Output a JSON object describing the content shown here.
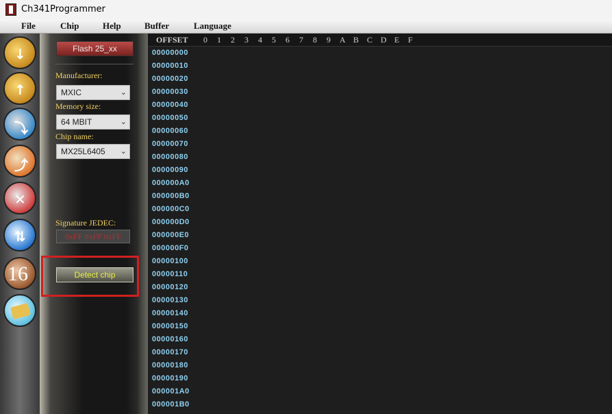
{
  "window": {
    "title": "Ch341Programmer"
  },
  "menu": {
    "items": [
      "File",
      "Chip",
      "Help",
      "Buffer",
      "Language"
    ]
  },
  "toolbar": {
    "buttons": [
      {
        "icon": "open-file-icon"
      },
      {
        "icon": "save-file-icon"
      },
      {
        "icon": "read-chip-icon"
      },
      {
        "icon": "write-chip-icon"
      },
      {
        "icon": "erase-chip-icon"
      },
      {
        "icon": "verify-chip-icon"
      },
      {
        "icon": "hex-mode-icon",
        "label": "16"
      },
      {
        "icon": "scroll-log-icon"
      }
    ]
  },
  "side": {
    "chip_type": "Flash 25_xx",
    "manufacturer_label": "Manufacturer:",
    "manufacturer_value": "MXIC",
    "memory_label": "Memory size:",
    "memory_value": "64 MBIT",
    "chip_name_label": "Chip name:",
    "chip_name_value": "MX25L6405",
    "signature_label": "Signature JEDEC:",
    "signature_value": "0xFF  0xFF  0xFF",
    "detect_button": "Detect chip"
  },
  "hex": {
    "offset_label": "OFFSET",
    "columns": [
      "0",
      "1",
      "2",
      "3",
      "4",
      "5",
      "6",
      "7",
      "8",
      "9",
      "A",
      "B",
      "C",
      "D",
      "E",
      "F"
    ],
    "rows": [
      "00000000",
      "00000010",
      "00000020",
      "00000030",
      "00000040",
      "00000050",
      "00000060",
      "00000070",
      "00000080",
      "00000090",
      "000000A0",
      "000000B0",
      "000000C0",
      "000000D0",
      "000000E0",
      "000000F0",
      "00000100",
      "00000110",
      "00000120",
      "00000130",
      "00000140",
      "00000150",
      "00000160",
      "00000170",
      "00000180",
      "00000190",
      "000001A0",
      "000001B0"
    ]
  },
  "colors": {
    "label": "#f0d060",
    "address": "#8fd0f0",
    "highlight": "#d02020"
  }
}
